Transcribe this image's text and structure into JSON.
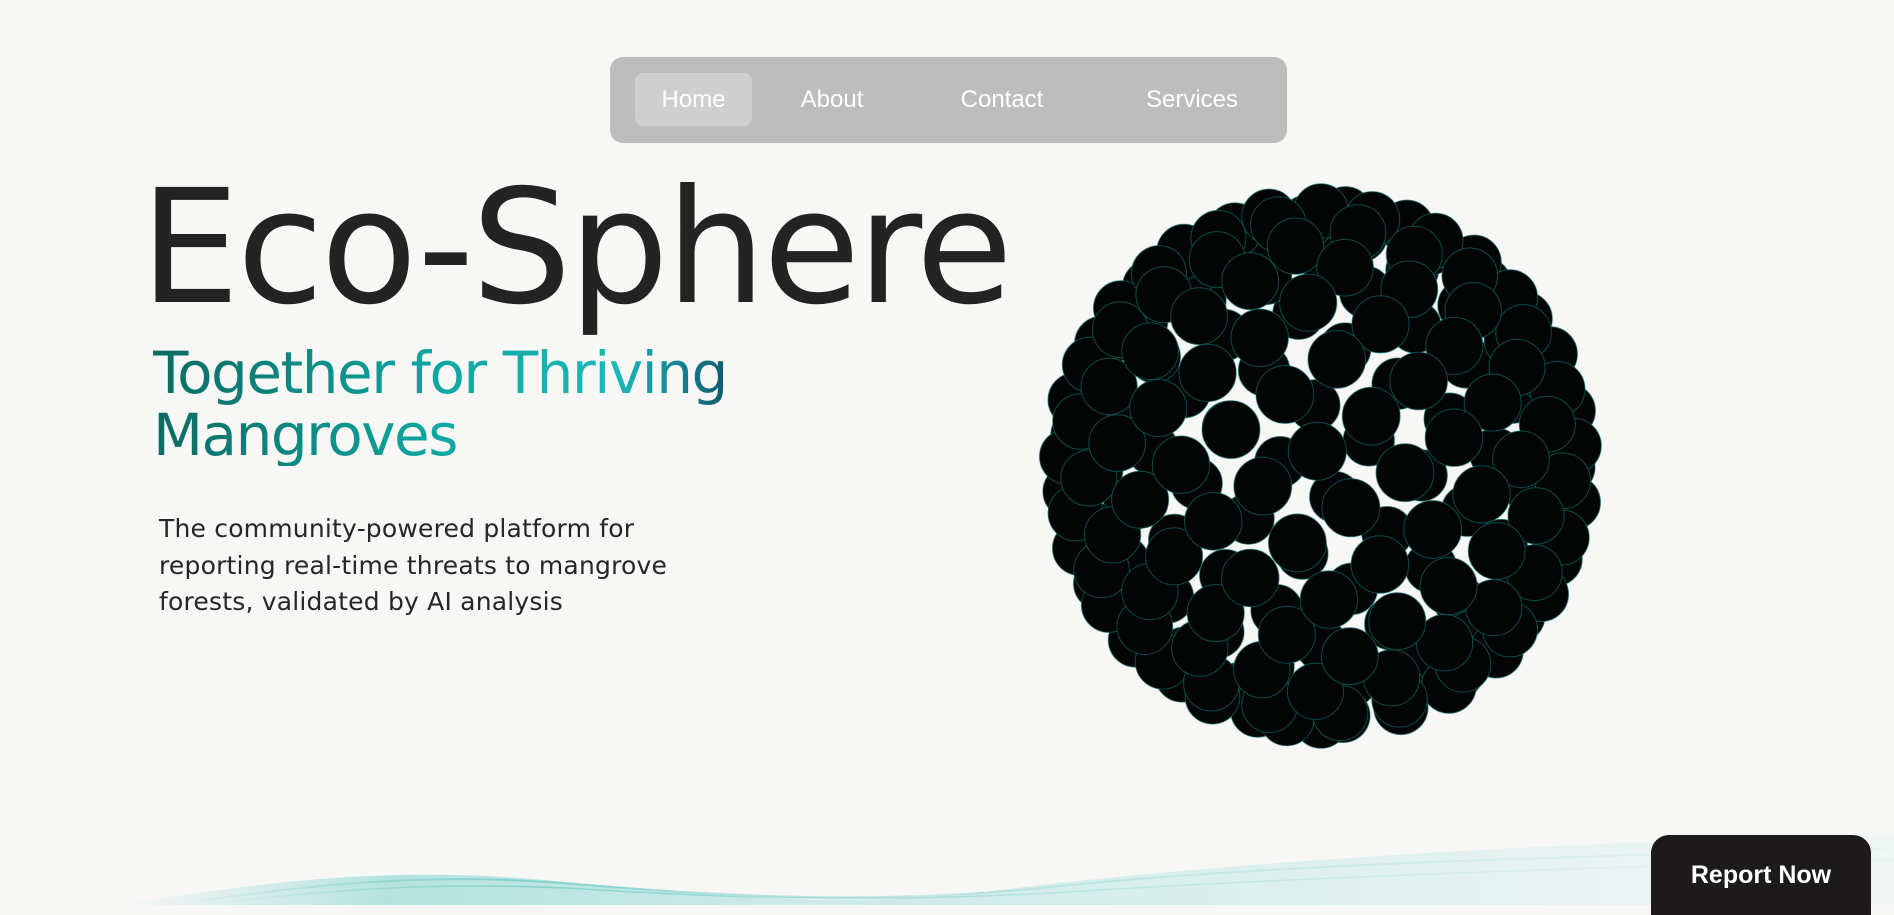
{
  "nav": {
    "items": [
      {
        "label": "Home",
        "active": true
      },
      {
        "label": "About",
        "active": false
      },
      {
        "label": "Contact",
        "active": false
      },
      {
        "label": "Services",
        "active": false
      }
    ]
  },
  "hero": {
    "title": "Eco-Sphere",
    "subtitle": "Together for Thriving Mangroves",
    "description": "The community-powered platform for reporting real-time threats to mangrove forests, validated by AI analysis"
  },
  "sphere": {
    "fill_color": "#030404",
    "edge_color": "#0e6a66"
  },
  "cta": {
    "label": "Report Now"
  },
  "colors": {
    "background": "#f7f7f6",
    "nav_background": "#bdbdbd",
    "accent_teal": "#0fa6a0",
    "title": "#232323",
    "button": "#1c1a1a"
  }
}
